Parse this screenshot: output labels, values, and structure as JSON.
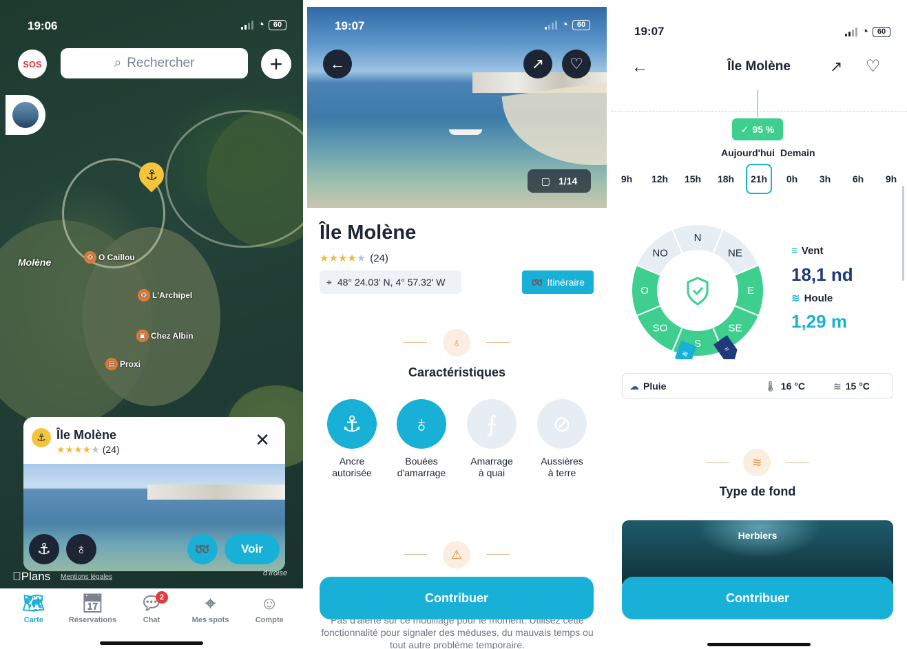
{
  "panel1": {
    "status": {
      "time": "19:06",
      "battery": "60"
    },
    "sos_label": "SOS",
    "search_placeholder": "Rechercher",
    "place_label": "Molène",
    "pois": [
      "O Caillou",
      "L'Archipel",
      "Chez Albin",
      "Proxi"
    ],
    "card": {
      "title": "Île Molène",
      "rating": 4,
      "reviews": "(24)"
    },
    "voir_label": "Voir",
    "attribution": {
      "plans": "Plans",
      "mentions": "Mentions légales",
      "map_label": "d'Iroise"
    },
    "tabs": [
      {
        "label": "Carte",
        "icon": "map-icon",
        "active": true
      },
      {
        "label": "Réservations",
        "icon": "calendar-icon"
      },
      {
        "label": "Chat",
        "icon": "chat-icon",
        "badge": "2"
      },
      {
        "label": "Mes spots",
        "icon": "pin-icon"
      },
      {
        "label": "Compte",
        "icon": "user-icon"
      }
    ]
  },
  "panel2": {
    "status": {
      "time": "19:07",
      "battery": "60"
    },
    "photo_counter": "1/14",
    "title": "Île Molène",
    "rating": 4,
    "reviews": "(24)",
    "coordinates": "48° 24.03' N, 4° 57.32' W",
    "itinerary_label": "Itinéraire",
    "features_title": "Caractéristiques",
    "features": [
      {
        "line1": "Ancre",
        "line2": "autorisée",
        "icon": "anchor-icon",
        "active": true
      },
      {
        "line1": "Bouées",
        "line2": "d'amarrage",
        "icon": "buoy-icon",
        "active": true
      },
      {
        "line1": "Amarrage",
        "line2": "à quai",
        "icon": "dock-icon",
        "active": false
      },
      {
        "line1": "Aussières",
        "line2": "à terre",
        "icon": "rope-icon",
        "active": false
      }
    ],
    "contribute_label": "Contribuer",
    "alert_text": "Pas d'alerte sur ce mouillage pour le moment. Utilisez cette fonctionnalité pour signaler des méduses, du mauvais temps ou tout autre problème temporaire."
  },
  "panel3": {
    "status": {
      "time": "19:07",
      "battery": "60"
    },
    "title": "Île Molène",
    "safety_pct": "95 %",
    "day_today": "Aujourd'hui",
    "day_tomorrow": "Demain",
    "hours": [
      "9h",
      "12h",
      "15h",
      "18h",
      "21h",
      "0h",
      "3h",
      "6h",
      "9h"
    ],
    "selected_hour_index": 4,
    "compass": [
      "N",
      "NE",
      "E",
      "SE",
      "S",
      "SO",
      "O",
      "NO"
    ],
    "wind_label": "Vent",
    "wind_value": "18,1 nd",
    "swell_label": "Houle",
    "swell_value": "1,29 m",
    "weather": "Pluie",
    "air_temp": "16 °C",
    "water_temp": "15 °C",
    "bottom_title": "Type de fond",
    "bottom_type": "Herbiers",
    "contribute_label": "Contribuer",
    "colors": {
      "safe_green": "#3ecf8e",
      "teal": "#19b0d8",
      "unsafe_grey": "#e6edf3"
    }
  }
}
